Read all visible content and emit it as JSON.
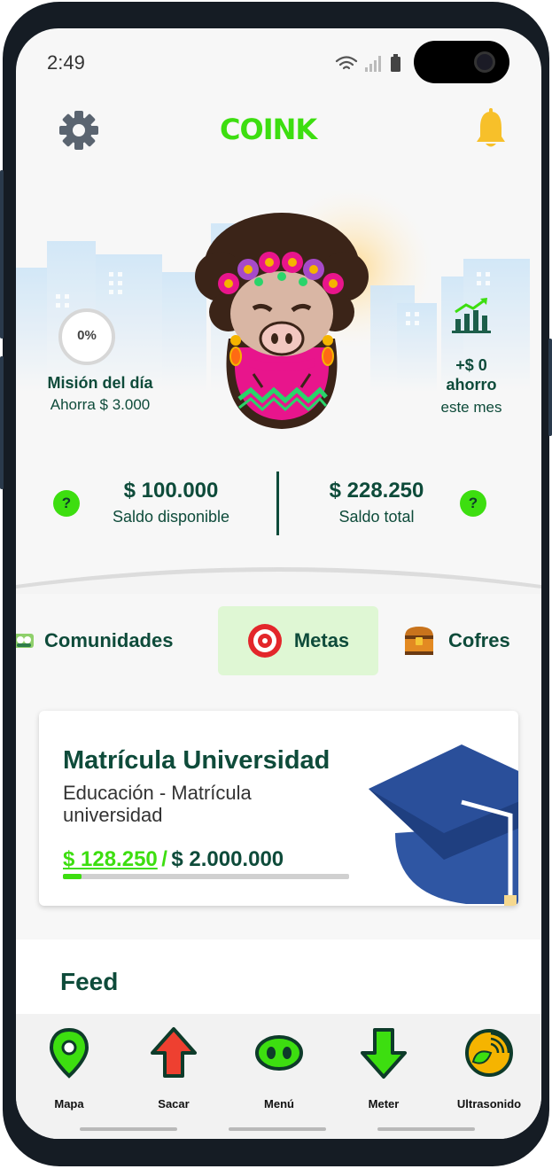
{
  "status_bar": {
    "time": "2:49"
  },
  "header": {
    "logo_text": "COINK"
  },
  "mission": {
    "percent": "0%",
    "title": "Misión del día",
    "subtitle": "Ahorra $ 3.000",
    "progress": 0
  },
  "monthly_savings": {
    "amount": "+$ 0",
    "label": "ahorro",
    "period": "este mes"
  },
  "balances": {
    "available": {
      "amount": "$ 100.000",
      "label": "Saldo disponible"
    },
    "total": {
      "amount": "$ 228.250",
      "label": "Saldo total"
    },
    "help_label": "?"
  },
  "tabs": [
    {
      "label": "Comunidades",
      "active": false
    },
    {
      "label": "Metas",
      "active": true
    },
    {
      "label": "Cofres",
      "active": false
    }
  ],
  "goal": {
    "title": "Matrícula Universidad",
    "category": "Educación - Matrícula universidad",
    "saved": "$ 128.250",
    "separator": "/",
    "target": "$ 2.000.000",
    "progress": 0.064
  },
  "feed": {
    "title": "Feed"
  },
  "bottom_nav": [
    {
      "label": "Mapa",
      "icon": "map-pin-icon"
    },
    {
      "label": "Sacar",
      "icon": "arrow-up-icon"
    },
    {
      "label": "Menú",
      "icon": "pig-nose-icon"
    },
    {
      "label": "Meter",
      "icon": "arrow-down-icon"
    },
    {
      "label": "Ultrasonido",
      "icon": "ultrasound-icon"
    }
  ],
  "colors": {
    "brand_green": "#3dde10",
    "dark_green": "#0e4b3a",
    "active_tab_bg": "#dff7d4",
    "bell": "#f7c02a"
  }
}
